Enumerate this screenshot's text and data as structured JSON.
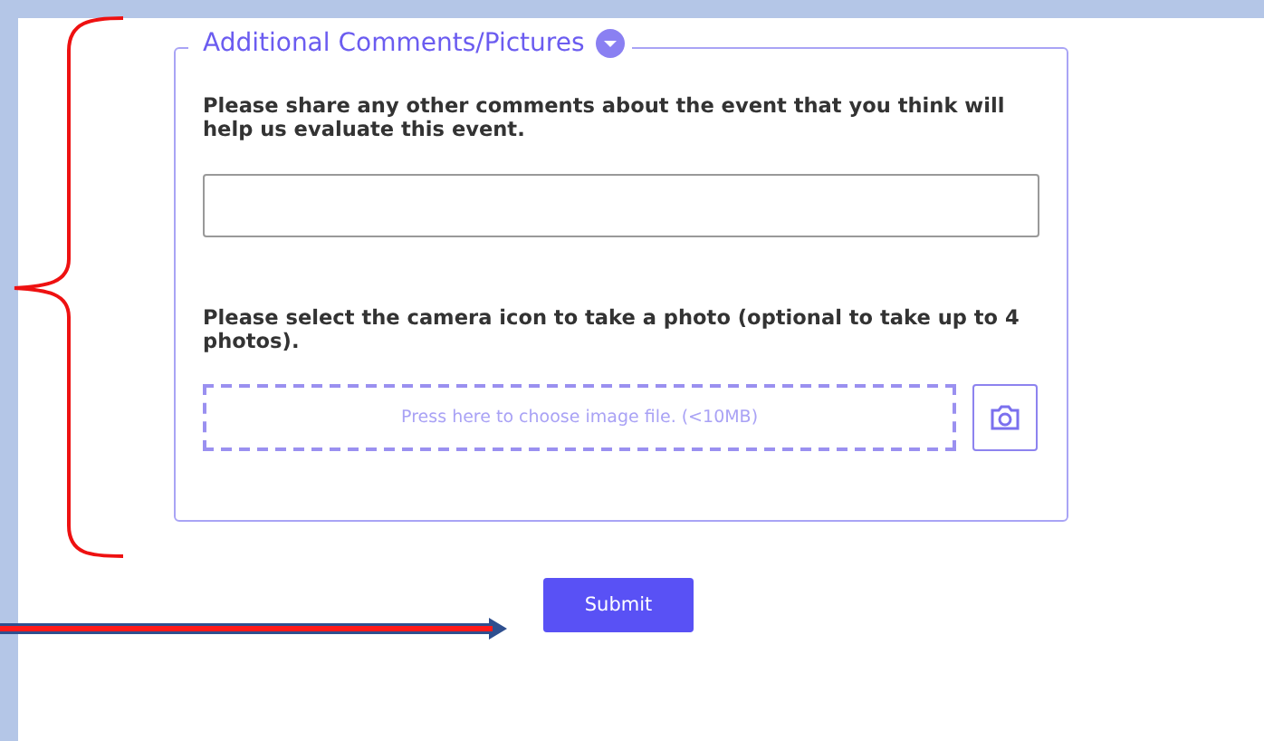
{
  "section": {
    "title": "Additional Comments/Pictures",
    "comments_prompt": "Please share any other comments about the event that you think will help us evaluate this event.",
    "photo_prompt": "Please select the camera icon to take a photo (optional to take up to 4 photos).",
    "file_dropzone": "Press here to choose image file. (<10MB)"
  },
  "submit_button": "Submit"
}
